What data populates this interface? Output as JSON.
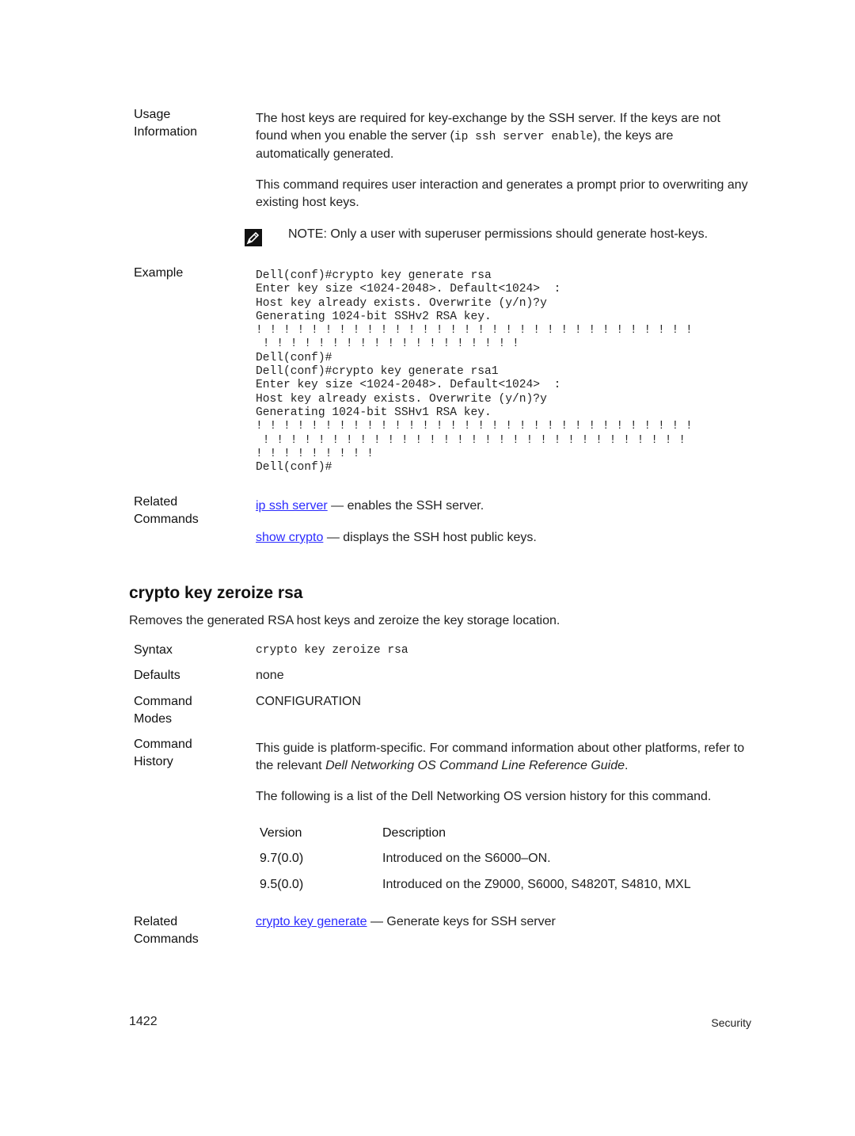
{
  "usage": {
    "label_line1": "Usage",
    "label_line2": "Information",
    "para1_a": "The host keys are required for key-exchange by the SSH server. If the keys are not found when you enable the server (",
    "para1_code": "ip ssh server enable",
    "para1_b": "), the keys are automatically generated.",
    "para2": "This command requires user interaction and generates a prompt prior to overwriting any existing host keys.",
    "note_icon": "pencil-note-icon",
    "note_label": "NOTE:",
    "note_text": " Only a user with superuser permissions should generate host-keys."
  },
  "example": {
    "label": "Example",
    "lines": [
      "Dell(conf)#crypto key generate rsa",
      "Enter key size <1024-2048>. Default<1024>  :",
      "Host key already exists. Overwrite (y/n)?y",
      "Generating 1024-bit SSHv2 RSA key.",
      "! ! ! ! ! ! ! ! ! ! ! ! ! ! ! ! ! ! ! ! ! ! ! ! ! ! ! ! ! ! ! !",
      " ! ! ! ! ! ! ! ! ! ! ! ! ! ! ! ! ! ! !",
      "Dell(conf)#",
      "Dell(conf)#crypto key generate rsa1",
      "Enter key size <1024-2048>. Default<1024>  :",
      "Host key already exists. Overwrite (y/n)?y",
      "Generating 1024-bit SSHv1 RSA key.",
      "! ! ! ! ! ! ! ! ! ! ! ! ! ! ! ! ! ! ! ! ! ! ! ! ! ! ! ! ! ! ! !",
      " ! ! ! ! ! ! ! ! ! ! ! ! ! ! ! ! ! ! ! ! ! ! ! ! ! ! ! ! ! ! !",
      "! ! ! ! ! ! ! ! !",
      "Dell(conf)#"
    ]
  },
  "related1": {
    "label_line1": "Related",
    "label_line2": "Commands",
    "items": [
      {
        "link": "ip ssh server",
        "desc": " — enables the SSH server."
      },
      {
        "link": "show crypto",
        "desc": " — displays the SSH host public keys."
      }
    ]
  },
  "section": {
    "title": "crypto key zeroize rsa",
    "description": "Removes the generated RSA host keys and zeroize the key storage location."
  },
  "syntax": {
    "label": "Syntax",
    "value": "crypto key zeroize rsa"
  },
  "defaults": {
    "label": "Defaults",
    "value": "none"
  },
  "modes": {
    "label_line1": "Command",
    "label_line2": "Modes",
    "value": "CONFIGURATION"
  },
  "history": {
    "label_line1": "Command",
    "label_line2": "History",
    "para1_a": "This guide is platform-specific. For command information about other platforms, refer to the relevant ",
    "para1_italic": "Dell Networking OS Command Line Reference Guide",
    "para1_b": ".",
    "para2": "The following is a list of the Dell Networking OS version history for this command.",
    "table": {
      "headers": [
        "Version",
        "Description"
      ],
      "rows": [
        [
          "9.7(0.0)",
          "Introduced on the S6000–ON."
        ],
        [
          "9.5(0.0)",
          "Introduced on the Z9000, S6000, S4820T, S4810, MXL"
        ]
      ]
    }
  },
  "related2": {
    "label_line1": "Related",
    "label_line2": "Commands",
    "items": [
      {
        "link": "crypto key generate",
        "desc": " — Generate keys for SSH server"
      }
    ]
  },
  "footer": {
    "page_number": "1422",
    "section": "Security"
  },
  "colors": {
    "link": "#2b2bff",
    "text": "#222222"
  }
}
